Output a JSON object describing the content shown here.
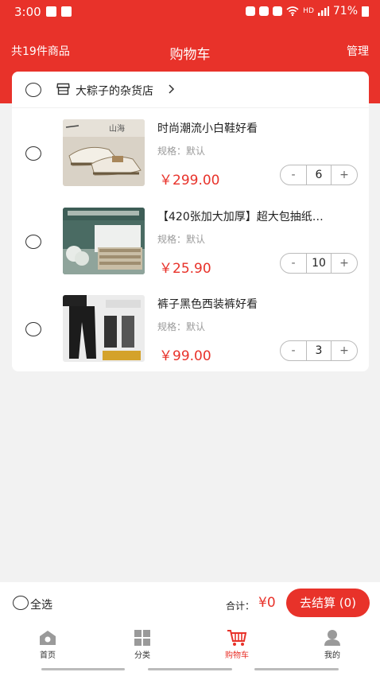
{
  "status": {
    "time": "3:00",
    "battery_pct": "71%",
    "net": "HD"
  },
  "header": {
    "count": "共19件商品",
    "title": "购物车",
    "manage": "管理"
  },
  "shop": {
    "name": "大粽子的杂货店",
    "chevron": ">"
  },
  "items": [
    {
      "name": "时尚潮流小白鞋好看",
      "spec": "规格：默认",
      "price": "￥299.00",
      "qty": "6",
      "minus": "-",
      "plus": "+"
    },
    {
      "name": "【420张加大加厚】超大包抽纸…",
      "spec": "规格：默认",
      "price": "￥25.90",
      "qty": "10",
      "minus": "-",
      "plus": "+"
    },
    {
      "name": "裤子黑色西装裤好看",
      "spec": "规格：默认",
      "price": "￥99.00",
      "qty": "3",
      "minus": "-",
      "plus": "+"
    }
  ],
  "footer": {
    "select_all": "全选",
    "total_label": "合计：",
    "total_value": "¥0",
    "checkout": "去结算 (0)"
  },
  "tabs": [
    {
      "label": "首页",
      "icon": "home-icon"
    },
    {
      "label": "分类",
      "icon": "category-icon"
    },
    {
      "label": "购物车",
      "icon": "cart-icon",
      "active": true
    },
    {
      "label": "我的",
      "icon": "profile-icon"
    }
  ],
  "colors": {
    "accent": "#e8322a",
    "background": "#f2f2f2"
  }
}
